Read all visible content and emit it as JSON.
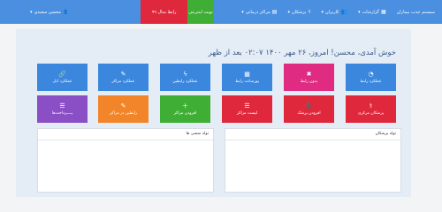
{
  "nav": {
    "brand": "سیستم جذب بیماران",
    "reports": "گزارشات",
    "users": "کاربران",
    "doctors": "پزشکان",
    "centers": "مراکز درمانی",
    "visit_button": "نوبت اینترنتی",
    "hotline_button": "رابط سال ۹۹",
    "user_name": "محسن سعیدی"
  },
  "welcome": "خوش آمدی، محسن! امروز، ۲۶ مهر ۱۴۰۰ ۰۲:۰۷ بعد از ظهر",
  "tiles": [
    {
      "label": "عملکرد رابط",
      "color": "#3b87de",
      "icon": "speedometer-icon"
    },
    {
      "label": "بدون رابط",
      "color": "#e02b82",
      "icon": "close-icon"
    },
    {
      "label": "پورسانت رابط",
      "color": "#3b87de",
      "icon": "table-icon"
    },
    {
      "label": "عملکرد رابطین",
      "color": "#3b87de",
      "icon": "bolt-icon"
    },
    {
      "label": "عملکرد مراکز",
      "color": "#3b87de",
      "icon": "pencil-icon"
    },
    {
      "label": "عملکرد کـل",
      "color": "#3b87de",
      "icon": "link-icon"
    },
    {
      "label": "پزشکان مرکزی",
      "color": "#e0283c",
      "icon": "user-md-icon"
    },
    {
      "label": "افزودن پزشک",
      "color": "#e0283c",
      "icon": "user-plus-icon"
    },
    {
      "label": "لیست مراکز",
      "color": "#e0283c",
      "icon": "list-icon"
    },
    {
      "label": "افزودن مراکز",
      "color": "#3fae35",
      "icon": "plus-icon"
    },
    {
      "label": "رابطین در مراکز",
      "color": "#f2852a",
      "icon": "pencil-icon"
    },
    {
      "label": "پــــرداخت‌ها",
      "color": "#8a4fc4",
      "icon": "list-icon"
    }
  ],
  "boxes": {
    "right_title": "تولد پزشکان",
    "left_title": "تولد منشی ها"
  }
}
